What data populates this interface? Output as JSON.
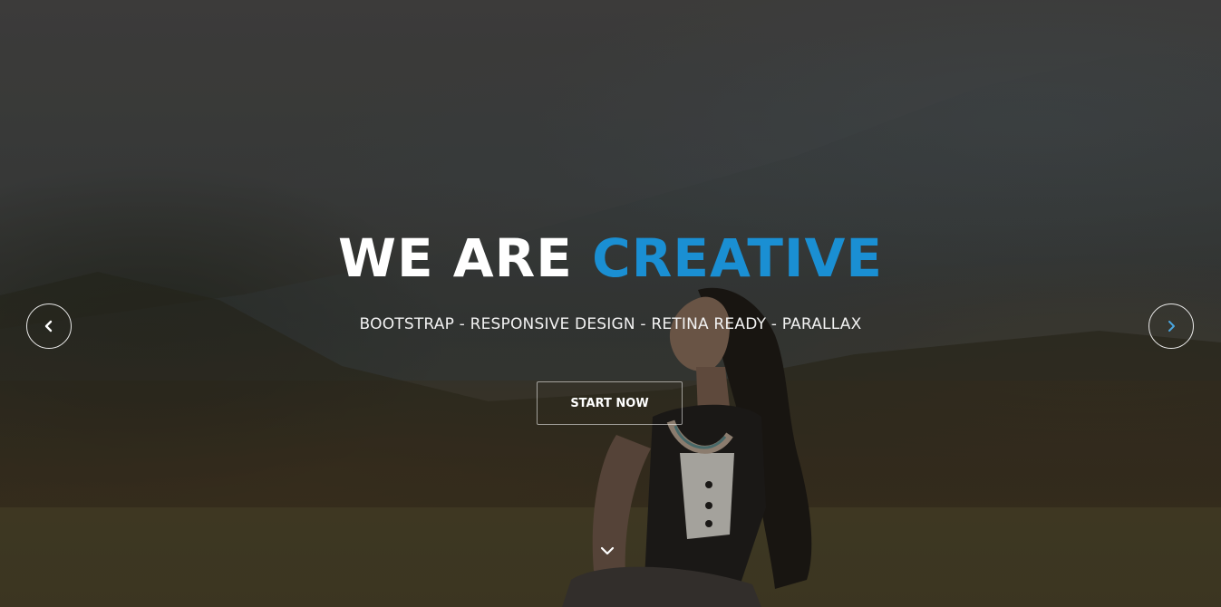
{
  "hero": {
    "headline_part1": "WE ARE",
    "headline_accent": "CREATIVE",
    "subtitle": "BOOTSTRAP - RESPONSIVE DESIGN - RETINA READY - PARALLAX",
    "cta_label": "START NOW"
  },
  "slider": {
    "prev_icon": "chevron-left-icon",
    "next_icon": "chevron-right-icon",
    "scroll_icon": "chevron-down-icon"
  },
  "colors": {
    "accent": "#1a8fd3",
    "text": "#ffffff",
    "next_arrow": "#4aa6e0"
  }
}
